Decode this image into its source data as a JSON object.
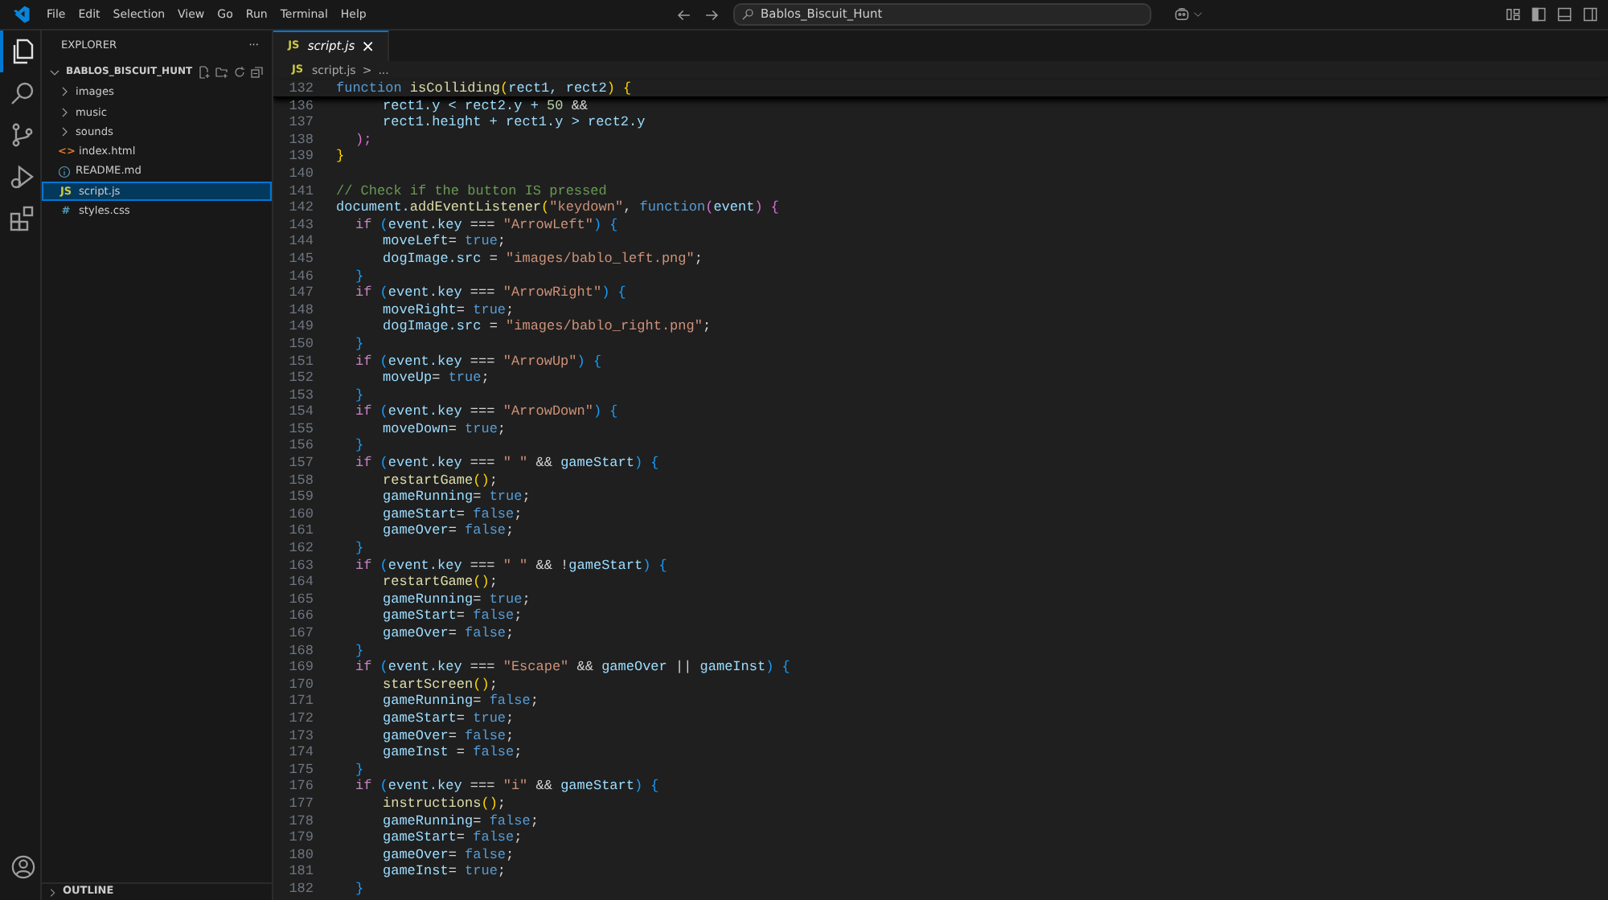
{
  "menu": [
    "File",
    "Edit",
    "Selection",
    "View",
    "Go",
    "Run",
    "Terminal",
    "Help"
  ],
  "search": {
    "value": "Bablos_Biscuit_Hunt"
  },
  "activity_bar": [
    {
      "kind": "files",
      "selected": true
    },
    {
      "kind": "search",
      "selected": false
    },
    {
      "kind": "source-control",
      "selected": false
    },
    {
      "kind": "run-debug",
      "selected": false
    },
    {
      "kind": "extensions",
      "selected": false
    }
  ],
  "sidebar": {
    "title": "EXPLORER",
    "more": "···",
    "folder": {
      "label": "BABLOS_BISCUIT_HUNT",
      "expanded": true,
      "children": [
        {
          "kind": "folder",
          "label": "images",
          "expanded": false,
          "selected": false
        },
        {
          "kind": "folder",
          "label": "music",
          "expanded": false,
          "selected": false
        },
        {
          "kind": "folder",
          "label": "sounds",
          "expanded": false,
          "selected": false
        },
        {
          "kind": "html",
          "icon": "<>",
          "label": "index.html",
          "selected": false
        },
        {
          "kind": "info",
          "label": "README.md",
          "selected": false
        },
        {
          "kind": "js",
          "icon": "JS",
          "label": "script.js",
          "selected": true
        },
        {
          "kind": "css",
          "icon": "#",
          "label": "styles.css",
          "selected": false
        }
      ]
    },
    "outline": {
      "label": "OUTLINE",
      "expanded": false
    }
  },
  "tabs": [
    {
      "icon": "JS",
      "label": "script.js",
      "selected": true,
      "close": "×"
    }
  ],
  "breadcrumb": {
    "icon": "JS",
    "file": "script.js",
    "sep": ">",
    "rest": "..."
  },
  "sticky_line": {
    "num": "132",
    "segments": [
      {
        "text": "function ",
        "color": "#569cd6"
      },
      {
        "text": "isColliding",
        "color": "#dcdcaa"
      },
      {
        "text": "(",
        "color": "#ffd700"
      },
      {
        "text": "rect1, rect2",
        "color": "#9cdcfe"
      },
      {
        "text": ") {",
        "color": "#ffd700"
      }
    ]
  },
  "lines": [
    {
      "num": "136",
      "segments": [
        {
          "text": "\t\trect1.y < rect2.y + ",
          "color": "#9cdcfe"
        },
        {
          "text": "50",
          "color": "#b5cea8"
        },
        {
          "text": " &&",
          "color": "#d4d4d4"
        }
      ]
    },
    {
      "num": "137",
      "segments": [
        {
          "text": "\t\trect1.height + rect1.y > rect2.y",
          "color": "#9cdcfe"
        }
      ]
    },
    {
      "num": "138",
      "segments": [
        {
          "text": "\t);",
          "color": "#da70d6"
        }
      ]
    },
    {
      "num": "139",
      "segments": [
        {
          "text": "}",
          "color": "#ffd700"
        }
      ]
    },
    {
      "num": "140"
    },
    {
      "num": "141",
      "segments": [
        {
          "text": "// Check if the button IS pressed",
          "color": "#6a9955"
        }
      ]
    },
    {
      "num": "142",
      "segments": [
        {
          "text": "document.",
          "color": "#9cdcfe"
        },
        {
          "text": "addEventListener",
          "color": "#dcdcaa"
        },
        {
          "text": "(",
          "color": "#ffd700"
        },
        {
          "text": "\"keydown\"",
          "color": "#ce9178"
        },
        {
          "text": ", ",
          "color": "#d4d4d4"
        },
        {
          "text": "function",
          "color": "#569cd6"
        },
        {
          "text": "(",
          "color": "#da70d6"
        },
        {
          "text": "event",
          "color": "#9cdcfe"
        },
        {
          "text": ") {",
          "color": "#da70d6"
        }
      ]
    },
    {
      "num": "143",
      "segments": [
        {
          "text": "\tif",
          "color": "#c586c0"
        },
        {
          "text": " (",
          "color": "#179fff"
        },
        {
          "text": "event.key",
          "color": "#9cdcfe"
        },
        {
          "text": " === ",
          "color": "#d4d4d4"
        },
        {
          "text": "\"ArrowLeft\"",
          "color": "#ce9178"
        },
        {
          "text": ") {",
          "color": "#179fff"
        }
      ]
    },
    {
      "num": "144",
      "segments": [
        {
          "text": "\t\tmoveLeft",
          "color": "#9cdcfe"
        },
        {
          "text": "= ",
          "color": "#d4d4d4"
        },
        {
          "text": "true",
          "color": "#569cd6"
        },
        {
          "text": ";",
          "color": "#d4d4d4"
        }
      ]
    },
    {
      "num": "145",
      "segments": [
        {
          "text": "\t\tdogImage.src",
          "color": "#9cdcfe"
        },
        {
          "text": " = ",
          "color": "#d4d4d4"
        },
        {
          "text": "\"images/bablo_left.png\"",
          "color": "#ce9178"
        },
        {
          "text": ";",
          "color": "#d4d4d4"
        }
      ]
    },
    {
      "num": "146",
      "segments": [
        {
          "text": "\t}",
          "color": "#179fff"
        }
      ]
    },
    {
      "num": "147",
      "segments": [
        {
          "text": "\tif",
          "color": "#c586c0"
        },
        {
          "text": " (",
          "color": "#179fff"
        },
        {
          "text": "event.key",
          "color": "#9cdcfe"
        },
        {
          "text": " === ",
          "color": "#d4d4d4"
        },
        {
          "text": "\"ArrowRight\"",
          "color": "#ce9178"
        },
        {
          "text": ") {",
          "color": "#179fff"
        }
      ]
    },
    {
      "num": "148",
      "segments": [
        {
          "text": "\t\tmoveRight",
          "color": "#9cdcfe"
        },
        {
          "text": "= ",
          "color": "#d4d4d4"
        },
        {
          "text": "true",
          "color": "#569cd6"
        },
        {
          "text": ";",
          "color": "#d4d4d4"
        }
      ]
    },
    {
      "num": "149",
      "segments": [
        {
          "text": "\t\tdogImage.src",
          "color": "#9cdcfe"
        },
        {
          "text": " = ",
          "color": "#d4d4d4"
        },
        {
          "text": "\"images/bablo_right.png\"",
          "color": "#ce9178"
        },
        {
          "text": ";",
          "color": "#d4d4d4"
        }
      ]
    },
    {
      "num": "150",
      "segments": [
        {
          "text": "\t}",
          "color": "#179fff"
        }
      ]
    },
    {
      "num": "151",
      "segments": [
        {
          "text": "\tif",
          "color": "#c586c0"
        },
        {
          "text": " (",
          "color": "#179fff"
        },
        {
          "text": "event.key",
          "color": "#9cdcfe"
        },
        {
          "text": " === ",
          "color": "#d4d4d4"
        },
        {
          "text": "\"ArrowUp\"",
          "color": "#ce9178"
        },
        {
          "text": ") {",
          "color": "#179fff"
        }
      ]
    },
    {
      "num": "152",
      "segments": [
        {
          "text": "\t\tmoveUp",
          "color": "#9cdcfe"
        },
        {
          "text": "= ",
          "color": "#d4d4d4"
        },
        {
          "text": "true",
          "color": "#569cd6"
        },
        {
          "text": ";",
          "color": "#d4d4d4"
        }
      ]
    },
    {
      "num": "153",
      "segments": [
        {
          "text": "\t}",
          "color": "#179fff"
        }
      ]
    },
    {
      "num": "154",
      "segments": [
        {
          "text": "\tif",
          "color": "#c586c0"
        },
        {
          "text": " (",
          "color": "#179fff"
        },
        {
          "text": "event.key",
          "color": "#9cdcfe"
        },
        {
          "text": " === ",
          "color": "#d4d4d4"
        },
        {
          "text": "\"ArrowDown\"",
          "color": "#ce9178"
        },
        {
          "text": ") {",
          "color": "#179fff"
        }
      ]
    },
    {
      "num": "155",
      "segments": [
        {
          "text": "\t\tmoveDown",
          "color": "#9cdcfe"
        },
        {
          "text": "= ",
          "color": "#d4d4d4"
        },
        {
          "text": "true",
          "color": "#569cd6"
        },
        {
          "text": ";",
          "color": "#d4d4d4"
        }
      ]
    },
    {
      "num": "156",
      "segments": [
        {
          "text": "\t}",
          "color": "#179fff"
        }
      ]
    },
    {
      "num": "157",
      "segments": [
        {
          "text": "\tif",
          "color": "#c586c0"
        },
        {
          "text": " (",
          "color": "#179fff"
        },
        {
          "text": "event.key",
          "color": "#9cdcfe"
        },
        {
          "text": " === ",
          "color": "#d4d4d4"
        },
        {
          "text": "\" \"",
          "color": "#ce9178"
        },
        {
          "text": " && ",
          "color": "#d4d4d4"
        },
        {
          "text": "gameStart",
          "color": "#9cdcfe"
        },
        {
          "text": ") {",
          "color": "#179fff"
        }
      ]
    },
    {
      "num": "158",
      "segments": [
        {
          "text": "\t\trestartGame",
          "color": "#dcdcaa"
        },
        {
          "text": "()",
          "color": "#ffd700"
        },
        {
          "text": ";",
          "color": "#d4d4d4"
        }
      ]
    },
    {
      "num": "159",
      "segments": [
        {
          "text": "\t\tgameRunning",
          "color": "#9cdcfe"
        },
        {
          "text": "= ",
          "color": "#d4d4d4"
        },
        {
          "text": "true",
          "color": "#569cd6"
        },
        {
          "text": ";",
          "color": "#d4d4d4"
        }
      ]
    },
    {
      "num": "160",
      "segments": [
        {
          "text": "\t\tgameStart",
          "color": "#9cdcfe"
        },
        {
          "text": "= ",
          "color": "#d4d4d4"
        },
        {
          "text": "false",
          "color": "#569cd6"
        },
        {
          "text": ";",
          "color": "#d4d4d4"
        }
      ]
    },
    {
      "num": "161",
      "segments": [
        {
          "text": "\t\tgameOver",
          "color": "#9cdcfe"
        },
        {
          "text": "= ",
          "color": "#d4d4d4"
        },
        {
          "text": "false",
          "color": "#569cd6"
        },
        {
          "text": ";",
          "color": "#d4d4d4"
        }
      ]
    },
    {
      "num": "162",
      "segments": [
        {
          "text": "\t}",
          "color": "#179fff"
        }
      ]
    },
    {
      "num": "163",
      "segments": [
        {
          "text": "\tif",
          "color": "#c586c0"
        },
        {
          "text": " (",
          "color": "#179fff"
        },
        {
          "text": "event.key",
          "color": "#9cdcfe"
        },
        {
          "text": " === ",
          "color": "#d4d4d4"
        },
        {
          "text": "\" \"",
          "color": "#ce9178"
        },
        {
          "text": " && !",
          "color": "#d4d4d4"
        },
        {
          "text": "gameStart",
          "color": "#9cdcfe"
        },
        {
          "text": ") {",
          "color": "#179fff"
        }
      ]
    },
    {
      "num": "164",
      "segments": [
        {
          "text": "\t\trestartGame",
          "color": "#dcdcaa"
        },
        {
          "text": "()",
          "color": "#ffd700"
        },
        {
          "text": ";",
          "color": "#d4d4d4"
        }
      ]
    },
    {
      "num": "165",
      "segments": [
        {
          "text": "\t\tgameRunning",
          "color": "#9cdcfe"
        },
        {
          "text": "= ",
          "color": "#d4d4d4"
        },
        {
          "text": "true",
          "color": "#569cd6"
        },
        {
          "text": ";",
          "color": "#d4d4d4"
        }
      ]
    },
    {
      "num": "166",
      "segments": [
        {
          "text": "\t\tgameStart",
          "color": "#9cdcfe"
        },
        {
          "text": "= ",
          "color": "#d4d4d4"
        },
        {
          "text": "false",
          "color": "#569cd6"
        },
        {
          "text": ";",
          "color": "#d4d4d4"
        }
      ]
    },
    {
      "num": "167",
      "segments": [
        {
          "text": "\t\tgameOver",
          "color": "#9cdcfe"
        },
        {
          "text": "= ",
          "color": "#d4d4d4"
        },
        {
          "text": "false",
          "color": "#569cd6"
        },
        {
          "text": ";",
          "color": "#d4d4d4"
        }
      ]
    },
    {
      "num": "168",
      "segments": [
        {
          "text": "\t}",
          "color": "#179fff"
        }
      ]
    },
    {
      "num": "169",
      "segments": [
        {
          "text": "\tif",
          "color": "#c586c0"
        },
        {
          "text": " (",
          "color": "#179fff"
        },
        {
          "text": "event.key",
          "color": "#9cdcfe"
        },
        {
          "text": " === ",
          "color": "#d4d4d4"
        },
        {
          "text": "\"Escape\"",
          "color": "#ce9178"
        },
        {
          "text": " && ",
          "color": "#d4d4d4"
        },
        {
          "text": "gameOver",
          "color": "#9cdcfe"
        },
        {
          "text": " || ",
          "color": "#d4d4d4"
        },
        {
          "text": "gameInst",
          "color": "#9cdcfe"
        },
        {
          "text": ") {",
          "color": "#179fff"
        }
      ]
    },
    {
      "num": "170",
      "segments": [
        {
          "text": "\t\tstartScreen",
          "color": "#dcdcaa"
        },
        {
          "text": "()",
          "color": "#ffd700"
        },
        {
          "text": ";",
          "color": "#d4d4d4"
        }
      ]
    },
    {
      "num": "171",
      "segments": [
        {
          "text": "\t\tgameRunning",
          "color": "#9cdcfe"
        },
        {
          "text": "= ",
          "color": "#d4d4d4"
        },
        {
          "text": "false",
          "color": "#569cd6"
        },
        {
          "text": ";",
          "color": "#d4d4d4"
        }
      ]
    },
    {
      "num": "172",
      "segments": [
        {
          "text": "\t\tgameStart",
          "color": "#9cdcfe"
        },
        {
          "text": "= ",
          "color": "#d4d4d4"
        },
        {
          "text": "true",
          "color": "#569cd6"
        },
        {
          "text": ";",
          "color": "#d4d4d4"
        }
      ]
    },
    {
      "num": "173",
      "segments": [
        {
          "text": "\t\tgameOver",
          "color": "#9cdcfe"
        },
        {
          "text": "= ",
          "color": "#d4d4d4"
        },
        {
          "text": "false",
          "color": "#569cd6"
        },
        {
          "text": ";",
          "color": "#d4d4d4"
        }
      ]
    },
    {
      "num": "174",
      "segments": [
        {
          "text": "\t\tgameInst",
          "color": "#9cdcfe"
        },
        {
          "text": " = ",
          "color": "#d4d4d4"
        },
        {
          "text": "false",
          "color": "#569cd6"
        },
        {
          "text": ";",
          "color": "#d4d4d4"
        }
      ]
    },
    {
      "num": "175",
      "segments": [
        {
          "text": "\t}",
          "color": "#179fff"
        }
      ]
    },
    {
      "num": "176",
      "segments": [
        {
          "text": "\tif",
          "color": "#c586c0"
        },
        {
          "text": " (",
          "color": "#179fff"
        },
        {
          "text": "event.key",
          "color": "#9cdcfe"
        },
        {
          "text": " === ",
          "color": "#d4d4d4"
        },
        {
          "text": "\"i\"",
          "color": "#ce9178"
        },
        {
          "text": " && ",
          "color": "#d4d4d4"
        },
        {
          "text": "gameStart",
          "color": "#9cdcfe"
        },
        {
          "text": ") {",
          "color": "#179fff"
        }
      ]
    },
    {
      "num": "177",
      "segments": [
        {
          "text": "\t\tinstructions",
          "color": "#dcdcaa"
        },
        {
          "text": "()",
          "color": "#ffd700"
        },
        {
          "text": ";",
          "color": "#d4d4d4"
        }
      ]
    },
    {
      "num": "178",
      "segments": [
        {
          "text": "\t\tgameRunning",
          "color": "#9cdcfe"
        },
        {
          "text": "= ",
          "color": "#d4d4d4"
        },
        {
          "text": "false",
          "color": "#569cd6"
        },
        {
          "text": ";",
          "color": "#d4d4d4"
        }
      ]
    },
    {
      "num": "179",
      "segments": [
        {
          "text": "\t\tgameStart",
          "color": "#9cdcfe"
        },
        {
          "text": "= ",
          "color": "#d4d4d4"
        },
        {
          "text": "false",
          "color": "#569cd6"
        },
        {
          "text": ";",
          "color": "#d4d4d4"
        }
      ]
    },
    {
      "num": "180",
      "segments": [
        {
          "text": "\t\tgameOver",
          "color": "#9cdcfe"
        },
        {
          "text": "= ",
          "color": "#d4d4d4"
        },
        {
          "text": "false",
          "color": "#569cd6"
        },
        {
          "text": ";",
          "color": "#d4d4d4"
        }
      ]
    },
    {
      "num": "181",
      "segments": [
        {
          "text": "\t\tgameInst",
          "color": "#9cdcfe"
        },
        {
          "text": "= ",
          "color": "#d4d4d4"
        },
        {
          "text": "true",
          "color": "#569cd6"
        },
        {
          "text": ";",
          "color": "#d4d4d4"
        }
      ]
    },
    {
      "num": "182",
      "segments": [
        {
          "text": "\t}",
          "color": "#179fff"
        }
      ]
    }
  ]
}
